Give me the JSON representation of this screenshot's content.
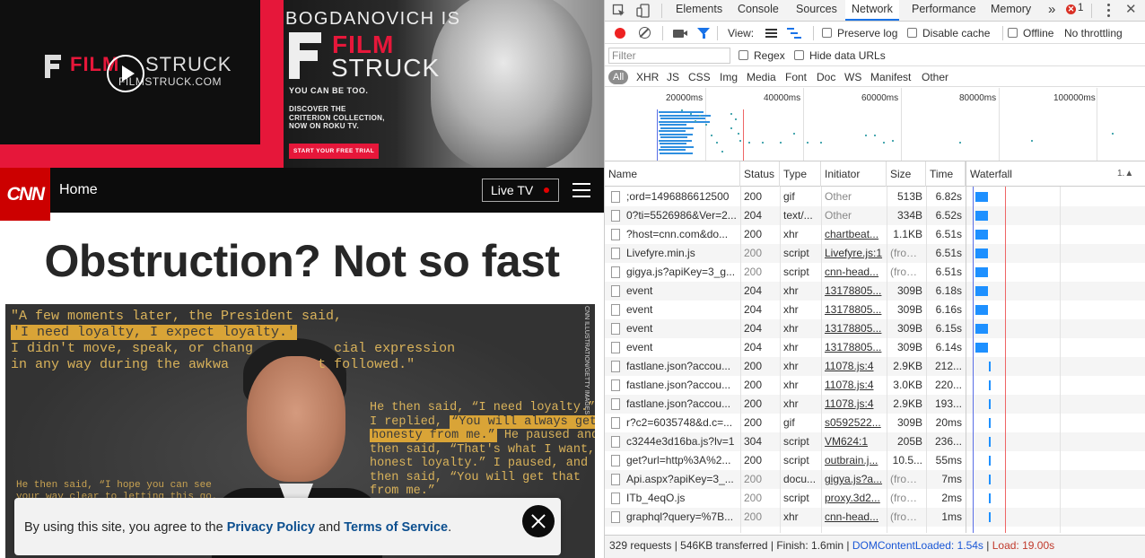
{
  "ad": {
    "video_logo_film": "FILM",
    "video_logo_struck": "STRUCK",
    "video_logo_url": "FILMSTRUCK.COM",
    "headline": "BOGDANOVICH IS",
    "brand_film": "FILM",
    "brand_struck": "STRUCK",
    "tagline": "YOU CAN BE TOO.",
    "body": "DISCOVER THE CRITERION COLLECTION, NOW ON ROKU TV.",
    "cta": "START YOUR FREE TRIAL",
    "accent": "#e6173a"
  },
  "cnn_nav": {
    "logo": "CNN",
    "home": "Home",
    "live_tv": "Live TV"
  },
  "article": {
    "title": "Obstruction? Not so fast",
    "hero": {
      "quote1_line1": "\"A few moments later, the President said,",
      "quote1_hl": "'I need loyalty, I expect loyalty.'",
      "quote1_line3a": "I didn't move, speak, or chang",
      "quote1_line3b": "cial expression",
      "quote1_line4a": "in any way during the awkwa",
      "quote1_line4b": "t followed.\"",
      "quote2_l1": "He then said, “I need loyalty.”",
      "quote2_l2a": "I replied, ",
      "quote2_l2hl": "“You will always get",
      "quote2_l3hl": "honesty from me.”",
      "quote2_l3b": " He paused and",
      "quote2_l4": "then said, “That's what I want,",
      "quote2_l5": "honest loyalty.” I paused, and",
      "quote2_l6": "then said, “You will get that",
      "quote2_l7": "from me.”",
      "quote3_l1": "He then said, “I hope you can see",
      "quote3_l2": "your way clear to letting this go,",
      "credit": "CNN ILLUSTRATION/GETTY IMAGES"
    }
  },
  "cookie": {
    "prefix": "By using this site, you agree to the ",
    "privacy": "Privacy Policy",
    "and": " and ",
    "terms": "Terms of Service",
    "suffix": "."
  },
  "devtools": {
    "tabs": [
      "Elements",
      "Console",
      "Sources",
      "Network",
      "Performance",
      "Memory"
    ],
    "active_tab": "Network",
    "more_tabs": "»",
    "error_count": "1",
    "close": "✕",
    "toolbar": {
      "view_label": "View:",
      "preserve_log": "Preserve log",
      "disable_cache": "Disable cache",
      "offline": "Offline",
      "throttling": "No throttling"
    },
    "filter": {
      "placeholder": "Filter",
      "regex": "Regex",
      "hide_data_urls": "Hide data URLs"
    },
    "types": [
      "All",
      "XHR",
      "JS",
      "CSS",
      "Img",
      "Media",
      "Font",
      "Doc",
      "WS",
      "Manifest",
      "Other"
    ],
    "overview_ticks": [
      "20000ms",
      "40000ms",
      "60000ms",
      "80000ms",
      "100000ms"
    ],
    "columns": [
      "Name",
      "Status",
      "Type",
      "Initiator",
      "Size",
      "Time",
      "Waterfall"
    ],
    "sort_indicator": "1.▲",
    "rows": [
      {
        "name": ";ord=1496886612500",
        "status": "200",
        "type": "gif",
        "initiator": "Other",
        "size": "513B",
        "time": "6.82s"
      },
      {
        "name": "0?ti=5526986&Ver=2...",
        "status": "204",
        "type": "text/...",
        "initiator": "Other",
        "size": "334B",
        "time": "6.52s"
      },
      {
        "name": "?host=cnn.com&do...",
        "status": "200",
        "type": "xhr",
        "initiator": "chartbeat...",
        "size": "1.1KB",
        "time": "6.51s"
      },
      {
        "name": "Livefyre.min.js",
        "status": "200",
        "type": "script",
        "initiator": "Livefyre.js:1",
        "size": "(from...",
        "time": "6.51s"
      },
      {
        "name": "gigya.js?apiKey=3_g...",
        "status": "200",
        "type": "script",
        "initiator": "cnn-head...",
        "size": "(from...",
        "time": "6.51s"
      },
      {
        "name": "event",
        "status": "204",
        "type": "xhr",
        "initiator": "13178805...",
        "size": "309B",
        "time": "6.18s"
      },
      {
        "name": "event",
        "status": "204",
        "type": "xhr",
        "initiator": "13178805...",
        "size": "309B",
        "time": "6.16s"
      },
      {
        "name": "event",
        "status": "204",
        "type": "xhr",
        "initiator": "13178805...",
        "size": "309B",
        "time": "6.15s"
      },
      {
        "name": "event",
        "status": "204",
        "type": "xhr",
        "initiator": "13178805...",
        "size": "309B",
        "time": "6.14s"
      },
      {
        "name": "fastlane.json?accou...",
        "status": "200",
        "type": "xhr",
        "initiator": "11078.js:4",
        "size": "2.9KB",
        "time": "212..."
      },
      {
        "name": "fastlane.json?accou...",
        "status": "200",
        "type": "xhr",
        "initiator": "11078.js:4",
        "size": "3.0KB",
        "time": "220..."
      },
      {
        "name": "fastlane.json?accou...",
        "status": "200",
        "type": "xhr",
        "initiator": "11078.js:4",
        "size": "2.9KB",
        "time": "193..."
      },
      {
        "name": "r?c2=6035748&d.c=...",
        "status": "200",
        "type": "gif",
        "initiator": "s0592522...",
        "size": "309B",
        "time": "20ms"
      },
      {
        "name": "c3244e3d16ba.js?lv=1",
        "status": "304",
        "type": "script",
        "initiator": "VM624:1",
        "size": "205B",
        "time": "236..."
      },
      {
        "name": "get?url=http%3A%2...",
        "status": "200",
        "type": "script",
        "initiator": "outbrain.j...",
        "size": "10.5...",
        "time": "55ms"
      },
      {
        "name": "Api.aspx?apiKey=3_...",
        "status": "200",
        "type": "docu...",
        "initiator": "gigya.js?a...",
        "size": "(from...",
        "time": "7ms"
      },
      {
        "name": "ITb_4eqO.js",
        "status": "200",
        "type": "script",
        "initiator": "proxy.3d2...",
        "size": "(from...",
        "time": "2ms"
      },
      {
        "name": "graphql?query=%7B...",
        "status": "200",
        "type": "xhr",
        "initiator": "cnn-head...",
        "size": "(from...",
        "time": "1ms"
      }
    ],
    "status_bar": {
      "summary": "329 requests | 546KB transferred | Finish: 1.6min | ",
      "dom_content_loaded": "DOMContentLoaded: 1.54s",
      "divider": " | ",
      "load": "Load: 19.00s"
    },
    "colors": {
      "accent_blue": "#1a73e8",
      "record_red": "#e22",
      "waterfall_bar": "#1e90ff",
      "dcl_line": "#5a6ee6",
      "load_line": "#e66"
    }
  }
}
